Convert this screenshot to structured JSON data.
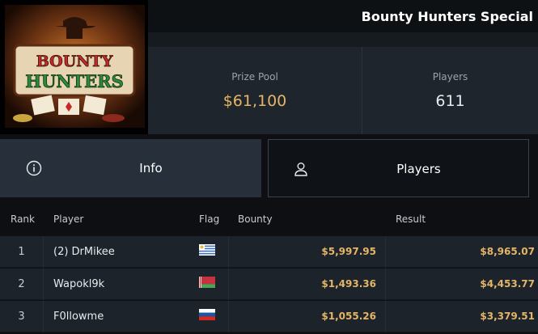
{
  "header": {
    "title": "Bounty Hunters Special"
  },
  "logo": {
    "lines": [
      "BOUNTY",
      "HUNTERS"
    ]
  },
  "stats": {
    "prize_pool": {
      "label": "Prize Pool",
      "value": "$61,100"
    },
    "players": {
      "label": "Players",
      "value": "611"
    }
  },
  "tabs": [
    {
      "label": "Info",
      "icon": "info-icon",
      "active": false
    },
    {
      "label": "Players",
      "icon": "user-icon",
      "active": true
    }
  ],
  "table": {
    "columns": [
      "Rank",
      "Player",
      "Flag",
      "Bounty",
      "Result"
    ],
    "rows": [
      {
        "rank": "1",
        "player": "(2) DrMikee",
        "flag": "uruguay-flag",
        "bounty": "$5,997.95",
        "result": "$8,965.07"
      },
      {
        "rank": "2",
        "player": "Wapokl9k",
        "flag": "belarus-flag",
        "bounty": "$1,493.36",
        "result": "$4,453.77"
      },
      {
        "rank": "3",
        "player": "F0llowme",
        "flag": "russia-flag",
        "bounty": "$1,055.26",
        "result": "$3,379.51"
      }
    ]
  },
  "colors": {
    "accent_gold": "#e5b567",
    "panel": "#1e252c",
    "tab_active_bg": "#27303a"
  }
}
